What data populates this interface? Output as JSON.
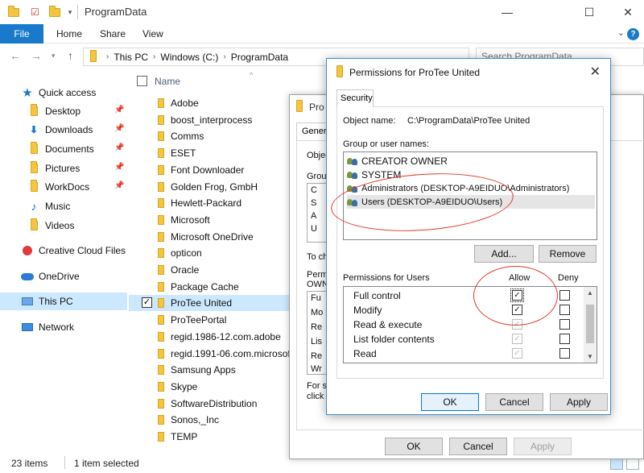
{
  "explorer": {
    "title": "ProgramData",
    "ribbon_tabs": {
      "file": "File",
      "home": "Home",
      "share": "Share",
      "view": "View"
    },
    "window_controls": {
      "minimize": "—",
      "maximize": "☐",
      "close": "✕"
    },
    "breadcrumbs": [
      "This PC",
      "Windows (C:)",
      "ProgramData"
    ],
    "search_placeholder": "Search ProgramData",
    "column_name": "Name",
    "nav": {
      "quick_access": "Quick access",
      "desktop": "Desktop",
      "downloads": "Downloads",
      "documents": "Documents",
      "pictures": "Pictures",
      "workdocs": "WorkDocs",
      "music": "Music",
      "videos": "Videos",
      "creative_cloud": "Creative Cloud Files",
      "onedrive": "OneDrive",
      "this_pc": "This PC",
      "network": "Network"
    },
    "files": [
      "Adobe",
      "boost_interprocess",
      "Comms",
      "ESET",
      "Font Downloader",
      "Golden Frog, GmbH",
      "Hewlett-Packard",
      "Microsoft",
      "Microsoft OneDrive",
      "opticon",
      "Oracle",
      "Package Cache",
      "ProTee United",
      "ProTeePortal",
      "regid.1986-12.com.adobe",
      "regid.1991-06.com.microsoft",
      "Samsung Apps",
      "Skype",
      "SoftwareDistribution",
      "Sonos,_Inc",
      "TEMP"
    ],
    "selected_file": "ProTee United",
    "status": {
      "items": "23 items",
      "selected": "1 item selected"
    }
  },
  "props_dialog": {
    "title": "Pro",
    "tab": "Genera",
    "obj_label": "Objec",
    "group_label": "Grou",
    "change_text": "To ch",
    "perm_label": "Permi",
    "owner_label": "OWN",
    "special_text": "For s",
    "click_text": "click",
    "user_initials": [
      "C",
      "S",
      "A",
      "U"
    ],
    "perm_initials": [
      "Fu",
      "Mo",
      "Re",
      "Lis",
      "Re",
      "Wr"
    ],
    "ok": "OK",
    "cancel": "Cancel",
    "apply": "Apply"
  },
  "permissions_dialog": {
    "title": "Permissions for ProTee United",
    "close": "✕",
    "tab_security": "Security",
    "object_name_label": "Object name:",
    "object_name_value": "C:\\ProgramData\\ProTee United",
    "group_label": "Group or user names:",
    "users": [
      "CREATOR OWNER",
      "SYSTEM",
      "Administrators (DESKTOP-A9EIDUO\\Administrators)",
      "Users (DESKTOP-A9EIDUO\\Users)"
    ],
    "selected_user": "Users (DESKTOP-A9EIDUO\\Users)",
    "add_button": "Add...",
    "remove_button": "Remove",
    "perms_for_label": "Permissions for Users",
    "allow_label": "Allow",
    "deny_label": "Deny",
    "permissions": [
      {
        "name": "Full control",
        "allow": "checked",
        "deny": "unchecked"
      },
      {
        "name": "Modify",
        "allow": "checked",
        "deny": "unchecked"
      },
      {
        "name": "Read & execute",
        "allow": "checked-disabled",
        "deny": "unchecked"
      },
      {
        "name": "List folder contents",
        "allow": "checked-disabled",
        "deny": "unchecked"
      },
      {
        "name": "Read",
        "allow": "checked-disabled",
        "deny": "unchecked"
      }
    ],
    "ok": "OK",
    "cancel": "Cancel",
    "apply": "Apply"
  },
  "colors": {
    "accent": "#1979ca",
    "selection": "#cce8ff",
    "annotation": "#e0382a"
  }
}
